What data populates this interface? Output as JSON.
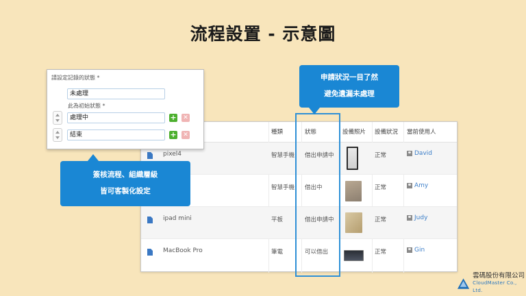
{
  "title": "流程設置 - 示意圖",
  "form": {
    "heading": "請設定記錄的狀態 *",
    "initial_value": "未處理",
    "initial_hint": "此為初始狀態 *",
    "states": [
      {
        "value": "處理中"
      },
      {
        "value": "結束"
      }
    ],
    "add_symbol": "+",
    "delete_symbol": "✕"
  },
  "callouts": {
    "top_line1": "申請狀況一目了然",
    "top_line2": "避免遺漏未處理",
    "left_line1": "簽核流程、組織層級",
    "left_line2": "皆可客製化設定"
  },
  "table": {
    "headers": [
      "種類",
      "狀態",
      "設備照片",
      "設備狀況",
      "當前使用人"
    ],
    "rows": [
      {
        "name": "pixel4",
        "type": "智慧手機",
        "status": "借出申請中",
        "condition": "正常",
        "user": "David"
      },
      {
        "name": "",
        "type": "智慧手機",
        "status": "借出中",
        "condition": "正常",
        "user": "Amy"
      },
      {
        "name": "ipad mini",
        "type": "平板",
        "status": "借出申請中",
        "condition": "正常",
        "user": "Judy"
      },
      {
        "name": "MacBook Pro",
        "type": "筆電",
        "status": "可以借出",
        "condition": "正常",
        "user": "Gin"
      }
    ]
  },
  "logo": {
    "name_cn": "雲碼股份有限公司",
    "name_en": "CloudMaster Co., Ltd."
  },
  "colors": {
    "background": "#f8e5bb",
    "accent": "#1a87d4",
    "link": "#3d7fc9",
    "add_button": "#4caf2e",
    "delete_button": "#f0b4b4"
  }
}
